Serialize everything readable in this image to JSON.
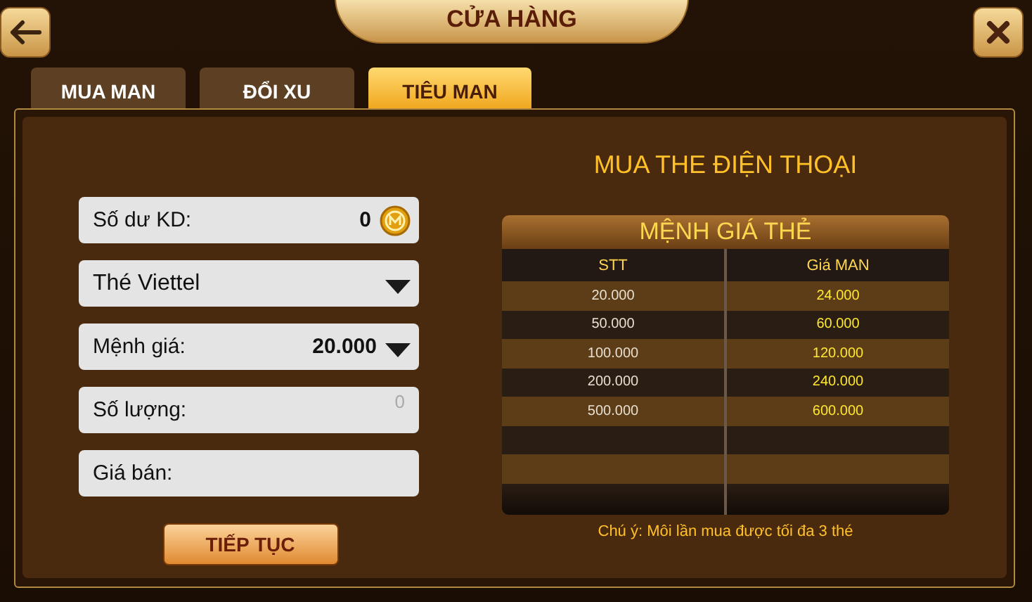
{
  "header": {
    "title": "CỬA HÀNG"
  },
  "tabs": [
    {
      "label": "MUA MAN",
      "selected": false
    },
    {
      "label": "ĐỔI XU",
      "selected": false
    },
    {
      "label": "TIÊU MAN",
      "selected": true
    }
  ],
  "form": {
    "fields": [
      {
        "kind": "balance",
        "label": "Số dư KD:",
        "value": "0"
      },
      {
        "kind": "dropdown",
        "value": "Thé Viettel"
      },
      {
        "kind": "dropdown",
        "label": "Mệnh giá:",
        "value": "20.000"
      },
      {
        "kind": "input",
        "label": "Số lượng:",
        "placeholder": "0"
      },
      {
        "kind": "input",
        "label": "Giá bán:"
      }
    ],
    "button": "TIẾP TỤC"
  },
  "price_panel": {
    "title": "MUA THE ĐIỆN THOẠI",
    "table": {
      "title": "MỆNH GIÁ THẺ",
      "columns": [
        "STT",
        "Giá MAN"
      ],
      "rows": [
        [
          "20.000",
          "24.000"
        ],
        [
          "50.000",
          "60.000"
        ],
        [
          "100.000",
          "120.000"
        ],
        [
          "200.000",
          "240.000"
        ],
        [
          "500.000",
          "600.000"
        ]
      ]
    },
    "note": "Chú ý: Môi lần mua được tối đa 3 thé"
  }
}
